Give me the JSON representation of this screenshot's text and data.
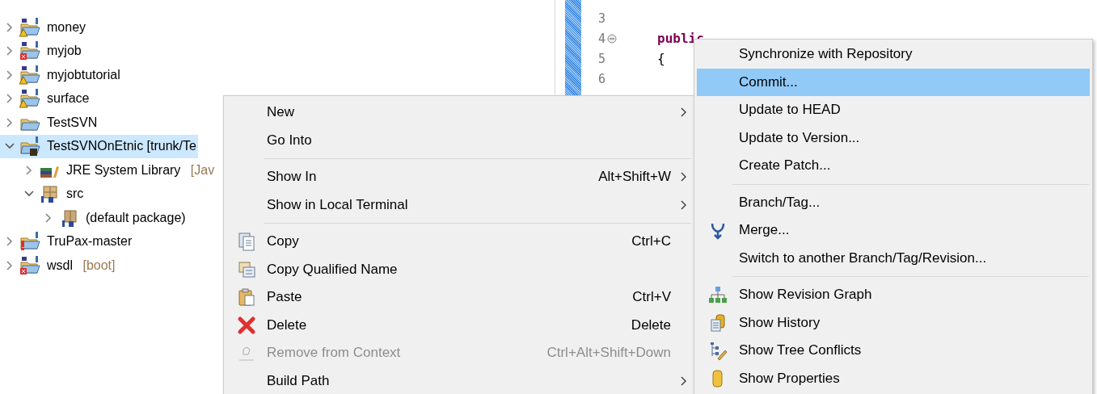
{
  "tree": [
    {
      "label": "money",
      "kind": "maven-warning",
      "expanded": false,
      "selected": false
    },
    {
      "label": "myjob",
      "kind": "maven-error",
      "expanded": false,
      "selected": false
    },
    {
      "label": "myjobtutorial",
      "kind": "maven-warning",
      "expanded": false,
      "selected": false
    },
    {
      "label": "surface",
      "kind": "maven-warning",
      "expanded": false,
      "selected": false
    },
    {
      "label": "TestSVN",
      "kind": "folder",
      "expanded": false,
      "selected": false
    },
    {
      "label": "TestSVNOnEtnic [trunk/Te",
      "kind": "svn-project",
      "expanded": true,
      "selected": true,
      "children": [
        {
          "label": "JRE System Library",
          "decoration": "[Jav",
          "kind": "library",
          "expanded": false,
          "selected": false
        },
        {
          "label": "src",
          "kind": "source-folder",
          "expanded": true,
          "selected": false,
          "children": [
            {
              "label": "(default package)",
              "kind": "package",
              "expanded": false,
              "selected": false
            }
          ]
        }
      ]
    },
    {
      "label": "TruPax-master",
      "kind": "project-alert",
      "expanded": false,
      "selected": false
    },
    {
      "label": "wsdl",
      "decoration": "[boot]",
      "kind": "maven-error",
      "expanded": false,
      "selected": false
    }
  ],
  "editor": {
    "lines": [
      {
        "number": "3",
        "folding": false
      },
      {
        "number": "4",
        "folding": true,
        "code": "public",
        "kind": "keyword"
      },
      {
        "number": "5",
        "folding": false,
        "code": "{",
        "kind": "plain"
      },
      {
        "number": "6",
        "folding": false
      }
    ]
  },
  "context_menu": {
    "items": [
      {
        "kind": "plain",
        "label": "New",
        "submenu": true,
        "disabled": false
      },
      {
        "kind": "plain",
        "label": "Go Into",
        "submenu": false,
        "disabled": false
      },
      {
        "kind": "separator"
      },
      {
        "kind": "plain",
        "label": "Show In",
        "shortcut": "Alt+Shift+W",
        "submenu": true,
        "disabled": false
      },
      {
        "kind": "plain",
        "label": "Show in Local Terminal",
        "submenu": true,
        "disabled": false
      },
      {
        "kind": "separator"
      },
      {
        "kind": "copy",
        "label": "Copy",
        "shortcut": "Ctrl+C",
        "submenu": false,
        "disabled": false
      },
      {
        "kind": "copy-name",
        "label": "Copy Qualified Name",
        "submenu": false,
        "disabled": false
      },
      {
        "kind": "paste",
        "label": "Paste",
        "shortcut": "Ctrl+V",
        "submenu": false,
        "disabled": false
      },
      {
        "kind": "delete",
        "label": "Delete",
        "shortcut": "Delete",
        "submenu": false,
        "disabled": false
      },
      {
        "kind": "remove",
        "label": "Remove from Context",
        "shortcut": "Ctrl+Alt+Shift+Down",
        "submenu": false,
        "disabled": true
      },
      {
        "kind": "plain",
        "label": "Build Path",
        "submenu": true,
        "disabled": false
      }
    ]
  },
  "submenu": {
    "items": [
      {
        "kind": "plain",
        "label": "Synchronize with Repository",
        "selected": false
      },
      {
        "kind": "plain",
        "label": "Commit...",
        "selected": true
      },
      {
        "kind": "plain",
        "label": "Update to HEAD",
        "selected": false
      },
      {
        "kind": "plain",
        "label": "Update to Version...",
        "selected": false
      },
      {
        "kind": "plain",
        "label": "Create Patch...",
        "selected": false
      },
      {
        "kind": "separator"
      },
      {
        "kind": "plain",
        "label": "Branch/Tag...",
        "selected": false
      },
      {
        "kind": "merge",
        "label": "Merge...",
        "selected": false
      },
      {
        "kind": "plain",
        "label": "Switch to another Branch/Tag/Revision...",
        "selected": false
      },
      {
        "kind": "separator"
      },
      {
        "kind": "revision-graph",
        "label": "Show Revision Graph",
        "selected": false
      },
      {
        "kind": "history",
        "label": "Show History",
        "selected": false
      },
      {
        "kind": "tree-conflicts",
        "label": "Show Tree Conflicts",
        "selected": false
      },
      {
        "kind": "properties",
        "label": "Show Properties",
        "selected": false
      }
    ]
  }
}
